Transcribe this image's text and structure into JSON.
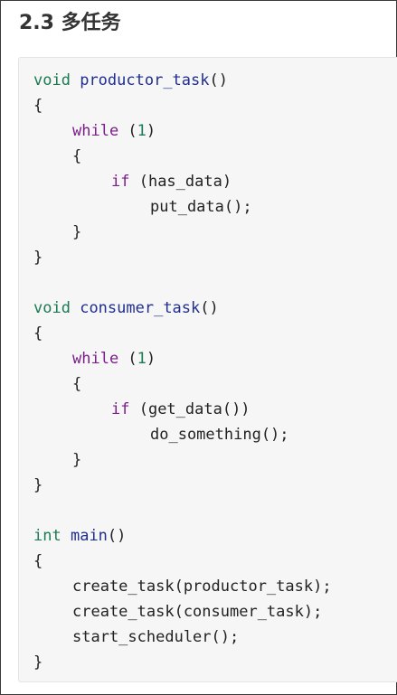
{
  "heading": "2.3 多任务",
  "code": {
    "l1": {
      "kw": "void",
      "fn": "productor_task",
      "rest": "()"
    },
    "l2": "{",
    "l3": {
      "kw": "while",
      "open": " (",
      "num": "1",
      "close": ")"
    },
    "l4": "{",
    "l5": {
      "kw": "if",
      "rest": " (has_data)"
    },
    "l6": "put_data();",
    "l7": "}",
    "l8": "}",
    "l10": {
      "kw": "void",
      "fn": "consumer_task",
      "rest": "()"
    },
    "l11": "{",
    "l12": {
      "kw": "while",
      "open": " (",
      "num": "1",
      "close": ")"
    },
    "l13": "{",
    "l14": {
      "kw": "if",
      "rest": " (get_data())"
    },
    "l15": "do_something();",
    "l16": "}",
    "l17": "}",
    "l19": {
      "kw": "int",
      "fn": "main",
      "rest": "()"
    },
    "l20": "{",
    "l21": "create_task(productor_task);",
    "l22": "create_task(consumer_task);",
    "l23": "start_scheduler();",
    "l24": "}"
  }
}
